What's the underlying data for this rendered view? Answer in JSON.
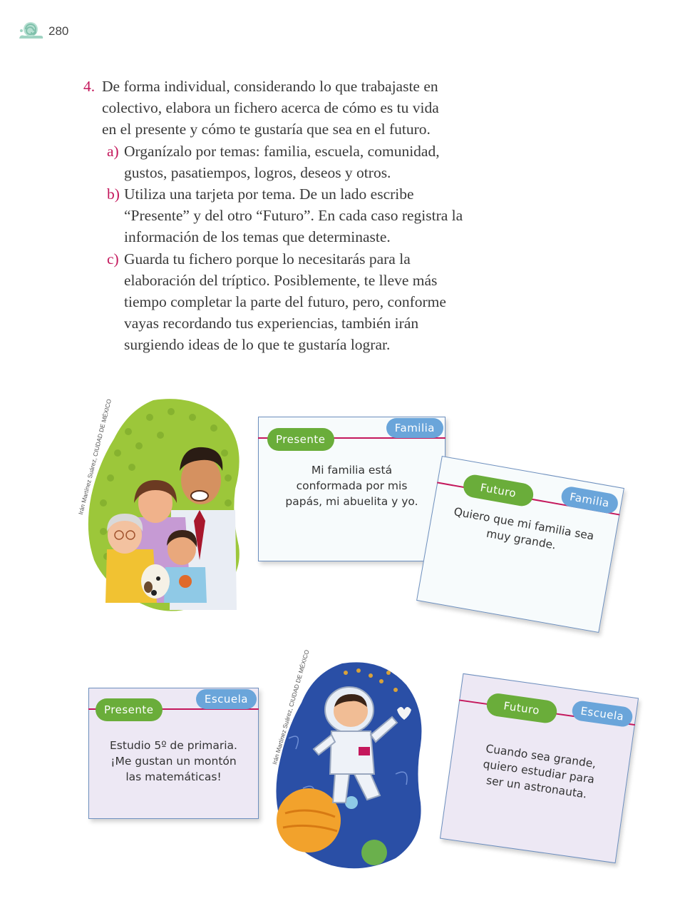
{
  "page": {
    "number": "280"
  },
  "task": {
    "number": "4.",
    "text": [
      "De forma individual, considerando lo que trabajaste en",
      "colectivo, elabora un fichero acerca de cómo es tu vida",
      "en el presente y cómo te gustaría que sea en el futuro."
    ],
    "items": [
      {
        "letter": "a)",
        "lines": [
          "Organízalo por temas: familia, escuela, comunidad,",
          "gustos, pasatiempos, logros, deseos y otros."
        ]
      },
      {
        "letter": "b)",
        "lines": [
          "Utiliza una tarjeta por tema. De un lado escribe",
          "“Presente” y del otro “Futuro”. En cada caso registra la",
          "información de los temas que determinaste."
        ]
      },
      {
        "letter": "c)",
        "lines": [
          "Guarda tu fichero porque lo necesitarás para la",
          "elaboración del tríptico. Posiblemente, te lleve más",
          "tiempo completar la parte del futuro, pero, conforme",
          "vayas recordando tus experiencias, también irán",
          "surgiendo ideas de lo que te gustaría lograr."
        ]
      }
    ]
  },
  "credits": {
    "family": "Irán Martínez Suárez, CIUDAD DE MÉXICO",
    "astronaut": "Irán Martínez Suárez, CIUDAD DE MÉXICO"
  },
  "cards": {
    "familia_presente": {
      "tab_left": "Presente",
      "tab_right": "Familia",
      "lines": [
        "Mi familia está",
        "conformada por mis",
        "papás, mi abuelita y yo."
      ]
    },
    "familia_futuro": {
      "tab_left": "Futuro",
      "tab_right": "Familia",
      "lines": [
        "Quiero que mi familia sea",
        "muy grande."
      ]
    },
    "escuela_presente": {
      "tab_left": "Presente",
      "tab_right": "Escuela",
      "lines": [
        "Estudio 5º de primaria.",
        "¡Me gustan un montón",
        "las matemáticas!"
      ]
    },
    "escuela_futuro": {
      "tab_left": "Futuro",
      "tab_right": "Escuela",
      "lines": [
        "Cuando sea grande,",
        "quiero estudiar para",
        "ser un astronauta."
      ]
    }
  },
  "colors": {
    "accent": "#c4185c",
    "tab_green": "#6aad3a",
    "tab_blue": "#6aa5da",
    "card_border": "#6d8fbe",
    "card_white": "#f7fbfc",
    "card_lilac": "#ede8f4"
  },
  "icons": {
    "header": "snail-icon"
  }
}
